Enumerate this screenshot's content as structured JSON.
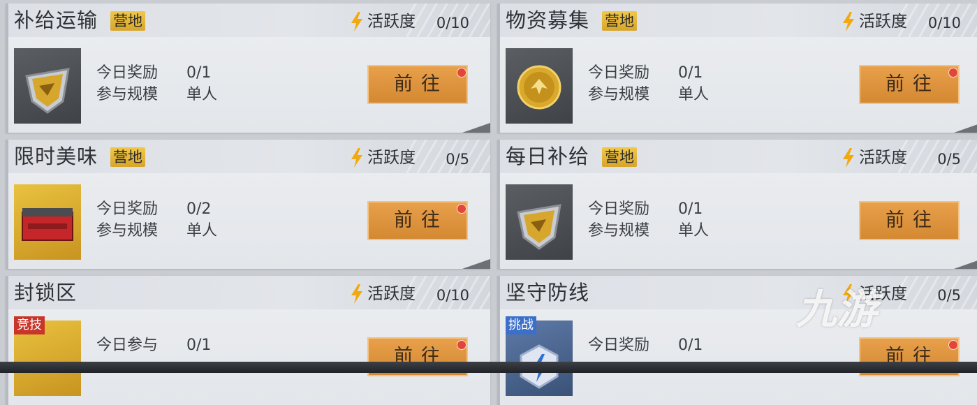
{
  "activity_label": "活跃度",
  "tag_camp": "营地",
  "button_label": "前往",
  "cards": [
    {
      "title": "补给运输",
      "tag": "营地",
      "activity": "0/10",
      "row1_label": "今日奖励",
      "row1_value": "0/1",
      "row2_label": "参与规模",
      "row2_value": "单人"
    },
    {
      "title": "物资募集",
      "tag": "营地",
      "activity": "0/10",
      "row1_label": "今日奖励",
      "row1_value": "0/1",
      "row2_label": "参与规模",
      "row2_value": "单人"
    },
    {
      "title": "限时美味",
      "tag": "营地",
      "activity": "0/5",
      "row1_label": "今日奖励",
      "row1_value": "0/2",
      "row2_label": "参与规模",
      "row2_value": "单人"
    },
    {
      "title": "每日补给",
      "tag": "营地",
      "activity": "0/5",
      "row1_label": "今日奖励",
      "row1_value": "0/1",
      "row2_label": "参与规模",
      "row2_value": "单人"
    },
    {
      "title": "封锁区",
      "badge": "竞技",
      "activity": "0/10",
      "row1_label": "今日参与",
      "row1_value": "0/1"
    },
    {
      "title": "坚守防线",
      "badge": "挑战",
      "activity": "0/5",
      "row1_label": "今日奖励",
      "row1_value": "0/1"
    }
  ],
  "watermark": "九游",
  "colors": {
    "accent_button": "#d48832",
    "tag_gold": "#e0b235",
    "badge_red": "#c8352a",
    "badge_blue": "#3b6fc9"
  }
}
